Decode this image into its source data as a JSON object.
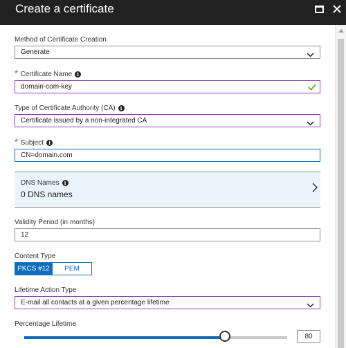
{
  "header": {
    "title": "Create a certificate"
  },
  "method": {
    "label": "Method of Certificate Creation",
    "value": "Generate"
  },
  "cert_name": {
    "required_mark": "*",
    "label": "Certificate Name",
    "value": "domain-com-key"
  },
  "ca_type": {
    "label": "Type of Certificate Authority (CA)",
    "value": "Certificate issued by a non-integrated CA"
  },
  "subject": {
    "required_mark": "*",
    "label": "Subject",
    "value": "CN=domain.com"
  },
  "dns": {
    "label": "DNS Names",
    "value": "0 DNS names"
  },
  "validity": {
    "label": "Validity Period (in months)",
    "value": "12"
  },
  "content_type": {
    "label": "Content Type",
    "options": [
      "PKCS #12",
      "PEM"
    ],
    "selected": "PKCS #12"
  },
  "lifetime_action": {
    "label": "Lifetime Action Type",
    "value": "E-mail all contacts at a given percentage lifetime"
  },
  "percentage": {
    "label": "Percentage Lifetime",
    "value": "80",
    "fraction": 0.8
  },
  "colors": {
    "accent": "#0f6cbd",
    "valid_border": "#8a3fb3",
    "required": "#e81123",
    "check": "#57a300",
    "titlebar": "#212121",
    "dns_bg": "#eaf5fb"
  }
}
